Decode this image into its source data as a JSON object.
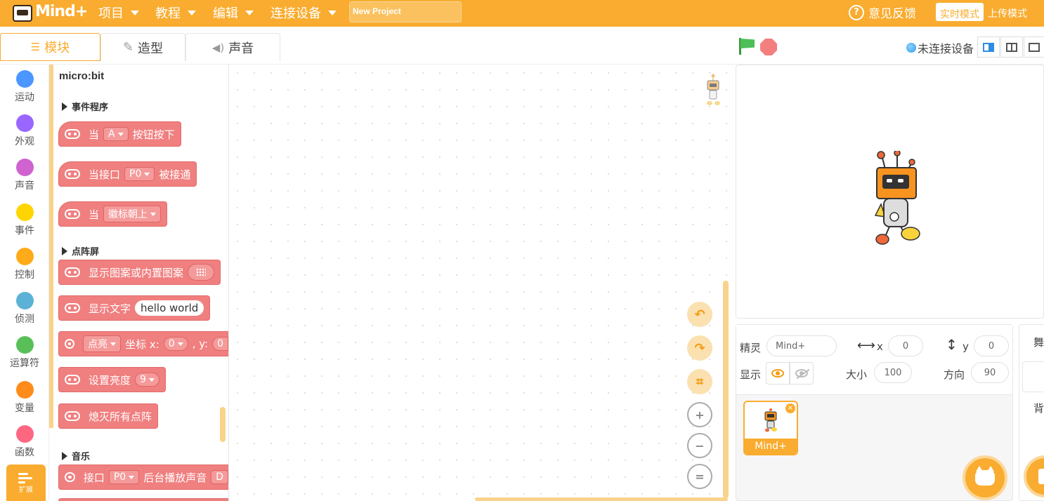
{
  "app": {
    "logo_text": "Mind+",
    "menus": [
      "项目",
      "教程",
      "编辑",
      "连接设备"
    ],
    "project_name": "New Project",
    "feedback_label": "意见反馈",
    "mode_realtime": "实时模式",
    "mode_upload": "上传模式"
  },
  "tabs": [
    "模块",
    "造型",
    "声音"
  ],
  "device_status": "未连接设备",
  "categories": [
    {
      "label": "运动",
      "color": "#4c97ff"
    },
    {
      "label": "外观",
      "color": "#9966ff"
    },
    {
      "label": "声音",
      "color": "#cf63cf"
    },
    {
      "label": "事件",
      "color": "#ffd500"
    },
    {
      "label": "控制",
      "color": "#ffab19"
    },
    {
      "label": "侦测",
      "color": "#5cb1d6"
    },
    {
      "label": "运算符",
      "color": "#59c059"
    },
    {
      "label": "变量",
      "color": "#ff8c1a"
    },
    {
      "label": "函数",
      "color": "#ff6680"
    }
  ],
  "extension_label": "扩展",
  "palette": {
    "title": "micro:bit",
    "sections": [
      "事件程序",
      "点阵屏",
      "音乐"
    ],
    "blocks": {
      "when_button": {
        "pre": "当",
        "dropdown": "A",
        "post": "按钮按下"
      },
      "when_pin": {
        "pre": "当接口",
        "dropdown": "P0",
        "post": "被接通"
      },
      "when_gesture": {
        "pre": "当",
        "dropdown": "徽标朝上"
      },
      "show_pattern": {
        "text": "显示图案或内置图案"
      },
      "show_text": {
        "text": "显示文字",
        "value": "hello world"
      },
      "plot": {
        "dropdown": "点亮",
        "mid": "坐标 x:",
        "x": "0",
        "y_label": ", y:",
        "y_cut": "0"
      },
      "brightness": {
        "text": "设置亮度",
        "value": "9"
      },
      "clear": {
        "text": "熄灭所有点阵"
      },
      "play_bg": {
        "pre": "接口",
        "dropdown": "P0",
        "post": "后台播放声音",
        "tail": "D"
      }
    }
  },
  "workspace_tools": {
    "undo": "↶",
    "redo": "↷",
    "crop": "⌗",
    "zoom_in": "+",
    "zoom_out": "−",
    "reset": "="
  },
  "sprite_info": {
    "sprite_label": "精灵",
    "sprite_name": "Mind+",
    "x_label": "x",
    "x_value": "0",
    "y_label": "y",
    "y_value": "0",
    "show_label": "显示",
    "size_label": "大小",
    "size_value": "100",
    "direction_label": "方向",
    "direction_value": "90"
  },
  "sprite_card": {
    "name": "Mind+"
  },
  "stage_panel": {
    "title_cut": "舞",
    "backdrop_cut": "背"
  }
}
